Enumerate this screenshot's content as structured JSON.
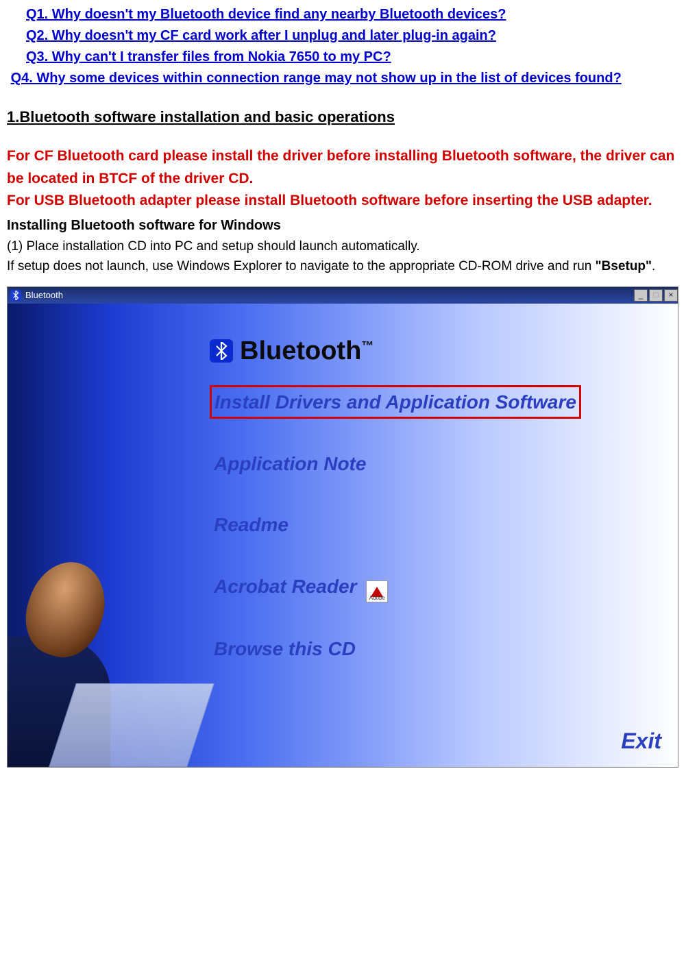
{
  "questions": {
    "q1": "Q1. Why doesn't my Bluetooth device find any nearby Bluetooth devices?",
    "q2": "Q2. Why doesn't my CF card work after I unplug and later plug-in again?",
    "q3": "Q3. Why can't I transfer files from Nokia 7650 to my PC?",
    "q4": "Q4. Why some devices within connection range may not show up in the list of devices found?"
  },
  "section_heading": "1.Bluetooth software installation and basic operations",
  "red_note": {
    "line1": "For CF Bluetooth card please install the driver before installing Bluetooth software, the driver can be located in BTCF of the driver CD.",
    "line2": "For USB Bluetooth adapter please install   Bluetooth software before inserting the USB adapter."
  },
  "sub_heading": "Installing Bluetooth software for Windows",
  "body": {
    "p1": "(1) Place installation CD into PC and setup should launch automatically.",
    "p2a": "If setup does not launch, use Windows Explorer to navigate to the appropriate CD-ROM drive and run ",
    "p2b": "\"Bsetup\"",
    "p2c": "."
  },
  "installer": {
    "window_title": "Bluetooth",
    "brand": "Bluetooth",
    "tm": "™",
    "items": {
      "install": "Install Drivers and Application Software",
      "appnote": "Application Note",
      "readme": "Readme",
      "acrobat": "Acrobat Reader",
      "browse": "Browse this CD"
    },
    "adobe_label": "Adobe",
    "exit": "Exit"
  }
}
